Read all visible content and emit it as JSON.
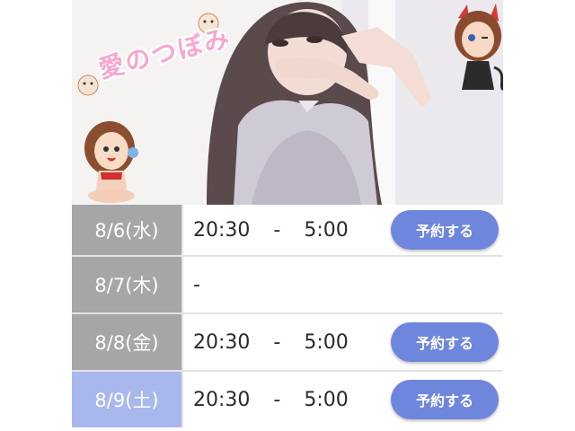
{
  "hero": {
    "logo_text": "愛のつぼみ"
  },
  "schedule": [
    {
      "date": "8/6(水)",
      "start": "20:30",
      "separator": "-",
      "end": "5:00",
      "button": "予約する"
    },
    {
      "date": "8/7(木)",
      "placeholder": "-"
    },
    {
      "date": "8/8(金)",
      "start": "20:30",
      "separator": "-",
      "end": "5:00",
      "button": "予約する"
    },
    {
      "date": "8/9(土)",
      "start": "20:30",
      "separator": "-",
      "end": "5:00",
      "button": "予約する"
    }
  ],
  "colors": {
    "weekday_cell": "#a6a6a6",
    "saturday_cell": "#a9b8ec",
    "button": "#6f86dd"
  }
}
